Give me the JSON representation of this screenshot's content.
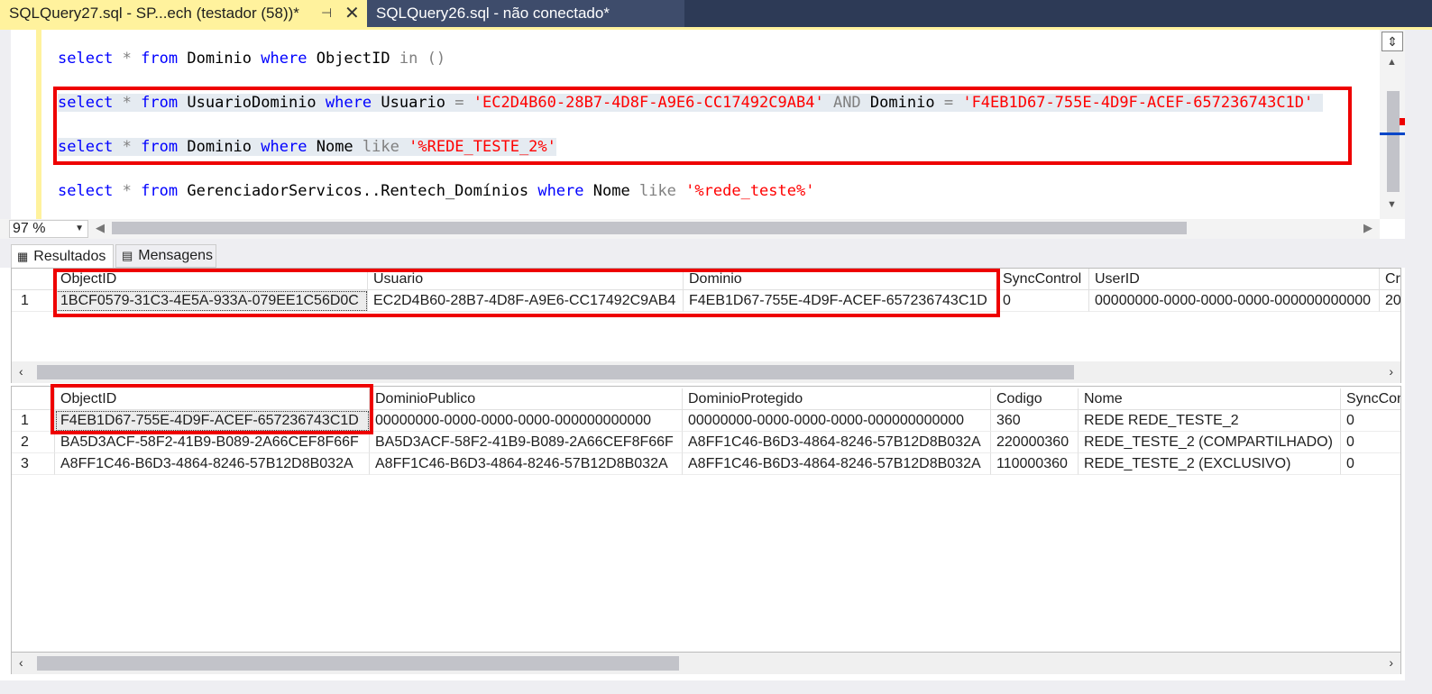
{
  "tabs": {
    "active": "SQLQuery27.sql - SP...ech (testador (58))*",
    "inactive": "SQLQuery26.sql - não conectado*"
  },
  "editor": {
    "line1": {
      "k1": "select",
      "s": "*",
      "k2": "from",
      "t": "Dominio",
      "k3": "where",
      "c": "ObjectID",
      "op": "in",
      "p": "()"
    },
    "line2": {
      "k1": "select",
      "s": "*",
      "k2": "from",
      "t": "UsuarioDominio",
      "k3": "where",
      "c1": "Usuario",
      "eq1": "=",
      "v1": "'EC2D4B60-28B7-4D8F-A9E6-CC17492C9AB4'",
      "and": "AND",
      "c2": "Dominio",
      "eq2": "=",
      "v2": "'F4EB1D67-755E-4D9F-ACEF-657236743C1D'"
    },
    "line3": {
      "k1": "select",
      "s": "*",
      "k2": "from",
      "t": "Dominio",
      "k3": "where",
      "c": "Nome",
      "op": "like",
      "v": "'%REDE_TESTE_2%'"
    },
    "line4": {
      "k1": "select",
      "s": "*",
      "k2": "from",
      "t": "GerenciadorServicos..Rentech_Domínios",
      "k3": "where",
      "c": "Nome",
      "op": "like",
      "v": "'%rede_teste%'"
    }
  },
  "zoom": "97 %",
  "result_tabs": {
    "results": "Resultados",
    "messages": "Mensagens"
  },
  "grid1": {
    "columns": [
      "ObjectID",
      "Usuario",
      "Dominio",
      "SyncControl",
      "UserID",
      "Cre"
    ],
    "rows": [
      [
        "1",
        "1BCF0579-31C3-4E5A-933A-079EE1C56D0C",
        "EC2D4B60-28B7-4D8F-A9E6-CC17492C9AB4",
        "F4EB1D67-755E-4D9F-ACEF-657236743C1D",
        "0",
        "00000000-0000-0000-0000-000000000000",
        "20"
      ]
    ]
  },
  "grid2": {
    "columns": [
      "ObjectID",
      "DominioPublico",
      "DominioProtegido",
      "Codigo",
      "Nome",
      "SyncCon"
    ],
    "rows": [
      [
        "1",
        "F4EB1D67-755E-4D9F-ACEF-657236743C1D",
        "00000000-0000-0000-0000-000000000000",
        "00000000-0000-0000-0000-000000000000",
        "360",
        "REDE REDE_TESTE_2",
        "0"
      ],
      [
        "2",
        "BA5D3ACF-58F2-41B9-B089-2A66CEF8F66F",
        "BA5D3ACF-58F2-41B9-B089-2A66CEF8F66F",
        "A8FF1C46-B6D3-4864-8246-57B12D8B032A",
        "220000360",
        "REDE_TESTE_2 (COMPARTILHADO)",
        "0"
      ],
      [
        "3",
        "A8FF1C46-B6D3-4864-8246-57B12D8B032A",
        "A8FF1C46-B6D3-4864-8246-57B12D8B032A",
        "A8FF1C46-B6D3-4864-8246-57B12D8B032A",
        "110000360",
        "REDE_TESTE_2 (EXCLUSIVO)",
        "0"
      ]
    ]
  },
  "colors": {
    "accent_tab": "#fff29d",
    "highlight_box": "#ee0000",
    "keyword": "#0000ff",
    "string": "#ff0000"
  }
}
